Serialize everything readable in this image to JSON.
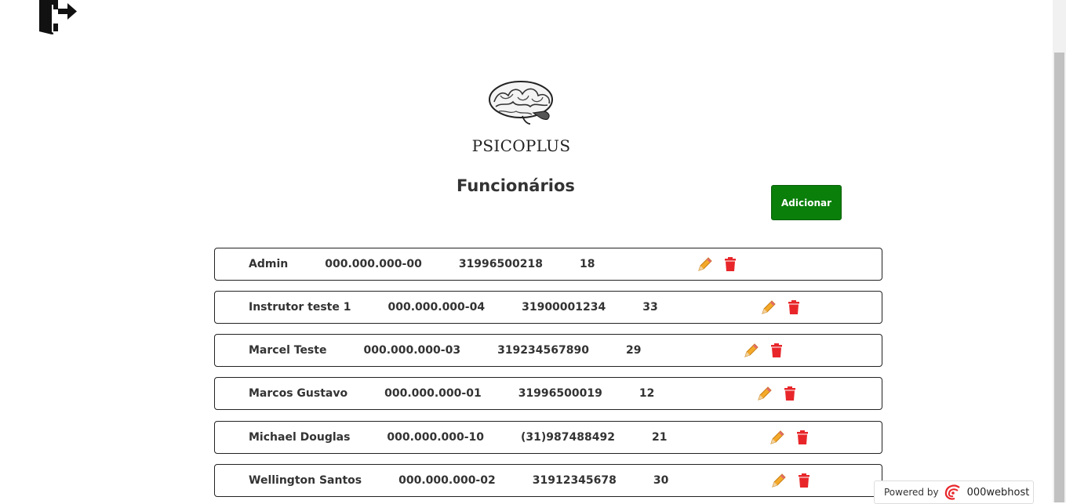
{
  "brand": {
    "name": "PSICOPLUS"
  },
  "page": {
    "title": "Funcionários"
  },
  "actions": {
    "add_label": "Adicionar"
  },
  "employees": [
    {
      "name": "Admin",
      "cpf": "000.000.000-00",
      "phone": "31996500218",
      "age": "18"
    },
    {
      "name": "Instrutor teste 1",
      "cpf": "000.000.000-04",
      "phone": "31900001234",
      "age": "33"
    },
    {
      "name": "Marcel Teste",
      "cpf": "000.000.000-03",
      "phone": "319234567890",
      "age": "29"
    },
    {
      "name": "Marcos Gustavo",
      "cpf": "000.000.000-01",
      "phone": "31996500019",
      "age": "12"
    },
    {
      "name": "Michael Douglas",
      "cpf": "000.000.000-10",
      "phone": "(31)987488492",
      "age": "21"
    },
    {
      "name": "Wellington Santos",
      "cpf": "000.000.000-02",
      "phone": "31912345678",
      "age": "30"
    }
  ],
  "footer": {
    "powered_by": "Powered by",
    "host_name": "000webhost"
  },
  "icons": {
    "logout": "logout-icon",
    "edit": "pencil-icon",
    "delete": "trash-icon",
    "logo": "brain-icon"
  },
  "colors": {
    "add_button": "#0a7f0a",
    "delete_icon": "#e8262a",
    "edit_icon": "#f4a92a"
  }
}
